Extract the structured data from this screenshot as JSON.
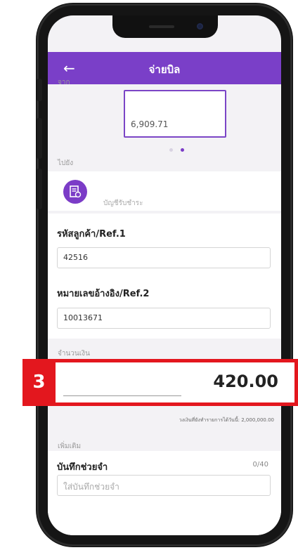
{
  "header": {
    "title": "จ่ายบิล",
    "back_icon": "←"
  },
  "from": {
    "label": "จาก",
    "account_balance": "6,909.71",
    "carousel_active_index": 1,
    "carousel_count": 2
  },
  "to": {
    "label": "ไปยัง",
    "biller_placeholder": "บัญชีรับชำระ"
  },
  "ref1": {
    "label": "รหัสลูกค้า/Ref.1",
    "value": "42516"
  },
  "ref2": {
    "label": "หมายเลขอ้างอิง/Ref.2",
    "value": "10013671"
  },
  "amount": {
    "label": "จำนวนเงิน",
    "value": "420.00",
    "limit_text": "วงเงินที่ยังทำรายการได้วันนี้: 2,000,000.00"
  },
  "extra": {
    "label": "เพิ่มเติม",
    "note_label": "บันทึกช่วยจำ",
    "note_counter": "0/40",
    "note_placeholder": "ใส่บันทึกช่วยจำ"
  },
  "annotation": {
    "step_number": "3"
  },
  "colors": {
    "brand_purple": "#7a3fc8",
    "highlight_red": "#e3171e"
  }
}
